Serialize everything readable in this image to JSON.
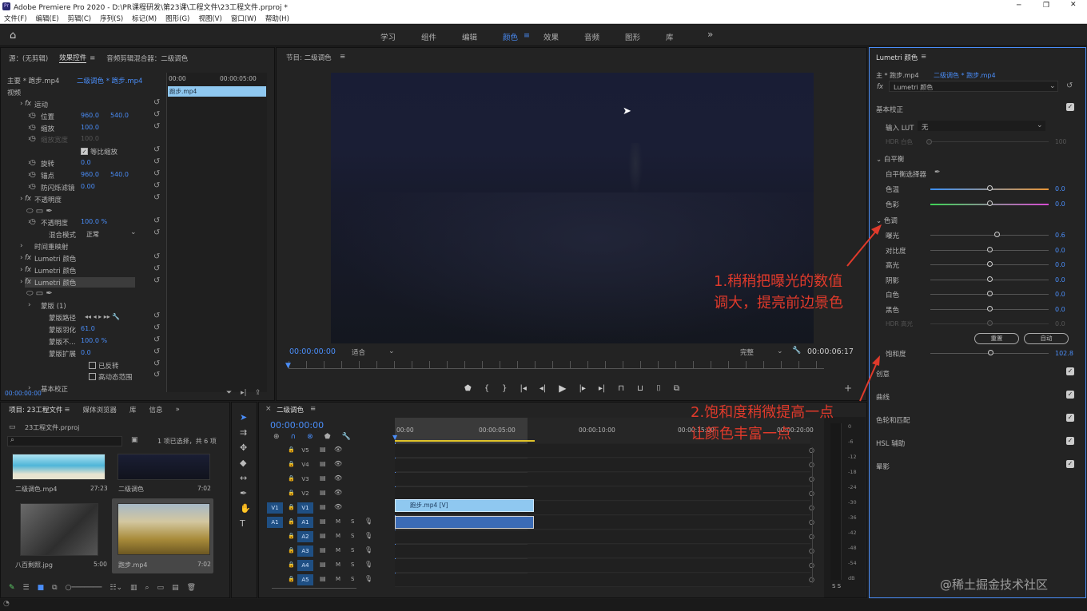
{
  "window": {
    "title": "Adobe Premiere Pro 2020 - D:\\PR课程研发\\第23课\\工程文件\\23工程文件.prproj *",
    "min": "─",
    "max": "❐",
    "close": "✕"
  },
  "menu": [
    "文件(F)",
    "编辑(E)",
    "剪辑(C)",
    "序列(S)",
    "标记(M)",
    "图形(G)",
    "视图(V)",
    "窗口(W)",
    "帮助(H)"
  ],
  "workspaces": [
    {
      "label": "学习",
      "active": false
    },
    {
      "label": "组件",
      "active": false
    },
    {
      "label": "编辑",
      "active": false
    },
    {
      "label": "颜色",
      "active": true
    },
    {
      "label": "效果",
      "active": false
    },
    {
      "label": "音频",
      "active": false
    },
    {
      "label": "图形",
      "active": false
    },
    {
      "label": "库",
      "active": false
    }
  ],
  "more": "»",
  "effect_controls": {
    "tabs": [
      "源：(无剪辑)",
      "效果控件",
      "音频剪辑混合器：二级调色"
    ],
    "menu": "≡",
    "master": "主要 * 跑步.mp4",
    "clip": "二级调色 * 跑步.mp4",
    "tc_start": "00:00",
    "tc_end": "00:00:05:00",
    "mini_clip": "跑步.mp4",
    "rows": [
      {
        "label": "视频",
        "indent": 0
      },
      {
        "label": "运动",
        "fx": true,
        "indent": 1
      },
      {
        "label": "位置",
        "indent": 2,
        "v1": "960.0",
        "v2": "540.0"
      },
      {
        "label": "缩放",
        "indent": 2,
        "v1": "100.0"
      },
      {
        "label": "缩放宽度",
        "indent": 2,
        "v1": "100.0",
        "dim": true
      },
      {
        "label": "等比缩放",
        "indent": 3,
        "check": true
      },
      {
        "label": "旋转",
        "indent": 2,
        "v1": "0.0"
      },
      {
        "label": "锚点",
        "indent": 2,
        "v1": "960.0",
        "v2": "540.0"
      },
      {
        "label": "防闪烁滤镜",
        "indent": 2,
        "v1": "0.00"
      },
      {
        "label": "不透明度",
        "fx": true,
        "indent": 1
      },
      {
        "label": "",
        "indent": 2,
        "shapes": true
      },
      {
        "label": "不透明度",
        "indent": 2,
        "v1": "100.0 %"
      },
      {
        "label": "混合模式",
        "indent": 3,
        "v1": "正常",
        "select": true
      },
      {
        "label": "时间重映射",
        "indent": 1
      },
      {
        "label": "Lumetri 颜色",
        "fx": true,
        "indent": 1
      },
      {
        "label": "Lumetri 颜色",
        "fx": true,
        "indent": 1
      },
      {
        "label": "Lumetri 颜色",
        "fx": true,
        "indent": 1,
        "hl": true
      },
      {
        "label": "",
        "indent": 2,
        "shapes": true
      },
      {
        "label": "蒙版 (1)",
        "indent": 2
      },
      {
        "label": "蒙版路径",
        "indent": 3,
        "transport": true
      },
      {
        "label": "蒙版羽化",
        "indent": 3,
        "v1": "61.0"
      },
      {
        "label": "蒙版不...",
        "indent": 3,
        "v1": "100.0 %"
      },
      {
        "label": "蒙版扩展",
        "indent": 3,
        "v1": "0.0"
      },
      {
        "label": "已反转",
        "indent": 4,
        "check": false
      },
      {
        "label": "高动态范围",
        "indent": 4,
        "check": false
      },
      {
        "label": "基本校正",
        "indent": 2
      }
    ],
    "timecode": "00:00:00:00"
  },
  "program": {
    "title": "节目: 二级调色",
    "menu": "≡",
    "timecode": "00:00:00:00",
    "fit": "适合",
    "quality": "完整",
    "duration": "00:00:06:17"
  },
  "project": {
    "tabs": [
      "项目: 23工程文件",
      "媒体浏览器",
      "库",
      "信息"
    ],
    "file": "23工程文件.prproj",
    "selection": "1 项已选择，共 6 项",
    "items": [
      {
        "name": "二级调色.mp4",
        "dur": "27:23"
      },
      {
        "name": "二级调色",
        "dur": "7:02"
      },
      {
        "name": "八百剩照.jpg",
        "dur": "5:00"
      },
      {
        "name": "跑步.mp4",
        "dur": "7:02"
      }
    ]
  },
  "timeline": {
    "title": "二级调色",
    "menu": "≡",
    "timecode": "00:00:00:00",
    "ruler": [
      "00:00",
      "00:00:05:00",
      "00:00:10:00",
      "00:00:15:00",
      "00:00:20:00"
    ],
    "video_tracks": [
      "V5",
      "V4",
      "V3",
      "V2",
      "V1"
    ],
    "audio_tracks": [
      "A1",
      "A2",
      "A3",
      "A4",
      "A5"
    ],
    "clip_v": "跑步.mp4 [V]",
    "meter": [
      "0",
      "-6",
      "-12",
      "-18",
      "-24",
      "-30",
      "-36",
      "-42",
      "-48",
      "-54",
      "dB"
    ],
    "meter_solo": "S  S"
  },
  "lumetri": {
    "title": "Lumetri 颜色",
    "menu": "≡",
    "master": "主 * 跑步.mp4",
    "clip": "二级调色 * 跑步.mp4",
    "effect": "Lumetri 颜色",
    "sections": {
      "basic": "基本校正",
      "creative": "创意",
      "curves": "曲线",
      "wheels": "色轮和匹配",
      "hsl": "HSL 辅助",
      "vignette": "晕影"
    },
    "input_lut": "输入 LUT",
    "lut_value": "无",
    "hdr_white": "HDR 白色",
    "hdr_white_val": "100",
    "wb": "白平衡",
    "wb_selector": "白平衡选择器",
    "temp": {
      "label": "色温",
      "value": "0.0",
      "pos": 0.5
    },
    "tint": {
      "label": "色彩",
      "value": "0.0",
      "pos": 0.5
    },
    "tone": "色调",
    "sliders": [
      {
        "label": "曝光",
        "value": "0.6",
        "pos": 0.56
      },
      {
        "label": "对比度",
        "value": "0.0",
        "pos": 0.5
      },
      {
        "label": "高光",
        "value": "0.0",
        "pos": 0.5
      },
      {
        "label": "阴影",
        "value": "0.0",
        "pos": 0.5
      },
      {
        "label": "白色",
        "value": "0.0",
        "pos": 0.5
      },
      {
        "label": "黑色",
        "value": "0.0",
        "pos": 0.5
      },
      {
        "label": "HDR 高光",
        "value": "0.0",
        "pos": 0.5,
        "dim": true
      }
    ],
    "reset": "重置",
    "auto": "自动",
    "saturation": {
      "label": "饱和度",
      "value": "102.8",
      "pos": 0.51
    }
  },
  "annotations": {
    "a1_line1": "1.稍稍把曝光的数值",
    "a1_line2": "调大，提亮前边景色",
    "a2_line1": "2.饱和度稍微提高一点",
    "a2_line2": "让颜色丰富一点"
  },
  "watermark": "@稀土掘金技术社区",
  "colors": {
    "accent": "#4a8df8",
    "bg": "#1d1d1d",
    "panel": "#232323",
    "annotation": "#e03a2b",
    "clip": "#8fc8f0"
  }
}
